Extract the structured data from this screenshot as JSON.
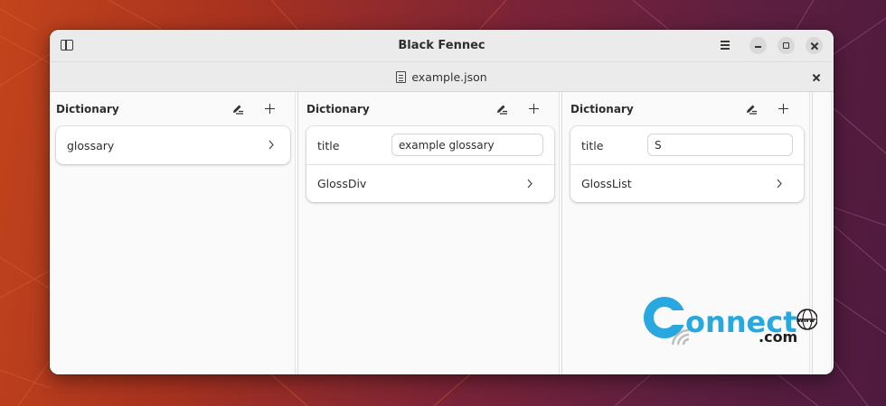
{
  "app": {
    "title": "Black Fennec"
  },
  "tabs": [
    {
      "label": "example.json"
    }
  ],
  "columns": [
    {
      "title": "Dictionary",
      "rows": [
        {
          "type": "nav",
          "label": "glossary"
        }
      ]
    },
    {
      "title": "Dictionary",
      "rows": [
        {
          "type": "field",
          "label": "title",
          "value": "example glossary"
        },
        {
          "type": "nav",
          "label": "GlossDiv"
        }
      ]
    },
    {
      "title": "Dictionary",
      "rows": [
        {
          "type": "field",
          "label": "title",
          "value": "S"
        },
        {
          "type": "nav",
          "label": "GlossList"
        }
      ]
    }
  ],
  "icons": {
    "sidebar_toggle": "sidebar-toggle-icon",
    "menu": "hamburger-menu-icon",
    "minimize": "minimize-icon",
    "maximize": "maximize-icon",
    "close": "close-icon",
    "file": "text-file-icon",
    "edit": "edit-pencil-icon",
    "add": "plus-icon",
    "chevron": "chevron-right-icon"
  },
  "watermark": {
    "text_main": "onnect",
    "text_sub": ".com",
    "globe_text": "www"
  },
  "colors": {
    "window_bg": "#fafafa",
    "titlebar_bg": "#ebebeb",
    "watermark_blue": "#29a8e0",
    "watermark_dark": "#1d1d1f"
  }
}
